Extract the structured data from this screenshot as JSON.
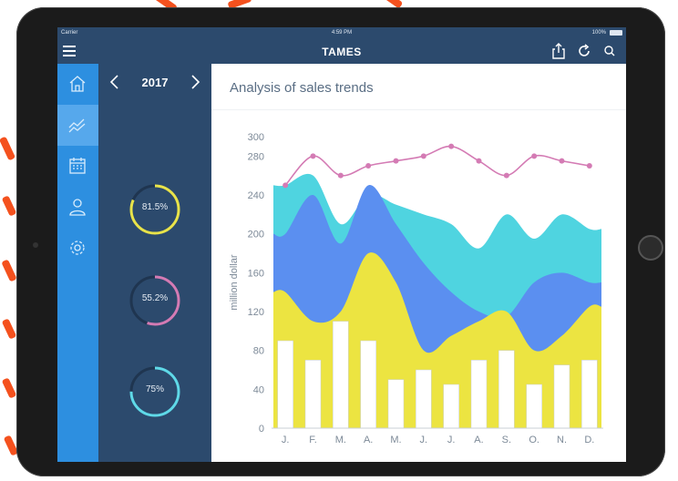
{
  "status_bar": {
    "carrier": "Carrier",
    "time": "4:59 PM",
    "battery": "100%"
  },
  "app": {
    "title": "TAMES"
  },
  "sidebar": {
    "items": [
      {
        "icon": "home-icon",
        "active": false
      },
      {
        "icon": "trend-icon",
        "active": true
      },
      {
        "icon": "calendar-icon",
        "active": false
      },
      {
        "icon": "user-icon",
        "active": false
      },
      {
        "icon": "settings-icon",
        "active": false
      }
    ]
  },
  "panel": {
    "year": "2017",
    "gauges": [
      {
        "label": "81.5%",
        "value": 0.815,
        "color": "#e8e34a"
      },
      {
        "label": "55.2%",
        "value": 0.552,
        "color": "#d47bb4"
      },
      {
        "label": "75%",
        "value": 0.75,
        "color": "#5fd9e8"
      }
    ],
    "gauge_track_color": "#1f3550"
  },
  "main": {
    "title": "Analysis of sales trends"
  },
  "chart_data": {
    "type": "area",
    "categories": [
      "J.",
      "F.",
      "M.",
      "A.",
      "M.",
      "J.",
      "J.",
      "A.",
      "S.",
      "O.",
      "N.",
      "D."
    ],
    "ylabel": "million dollar",
    "ylim": [
      0,
      300
    ],
    "yticks": [
      "0",
      "40",
      "80",
      "120",
      "160",
      "200",
      "240",
      "280",
      "300"
    ],
    "ytick_values": [
      0,
      40,
      80,
      120,
      160,
      200,
      240,
      280,
      300
    ],
    "grid": false,
    "series": [
      {
        "type": "line",
        "color": "#d47bb4",
        "values": [
          250,
          280,
          260,
          270,
          275,
          280,
          290,
          275,
          260,
          280,
          275,
          270
        ]
      },
      {
        "type": "area",
        "color": "#4fd4e0",
        "values": [
          250,
          260,
          210,
          240,
          230,
          220,
          210,
          185,
          220,
          195,
          220,
          205
        ]
      },
      {
        "type": "area",
        "color": "#5b8ff0",
        "values": [
          200,
          240,
          190,
          250,
          210,
          170,
          140,
          120,
          115,
          150,
          160,
          150
        ]
      },
      {
        "type": "area",
        "color": "#ece441",
        "values": [
          140,
          110,
          120,
          180,
          150,
          80,
          95,
          110,
          120,
          80,
          95,
          125
        ]
      },
      {
        "type": "bar",
        "color": "#ffffff",
        "values": [
          90,
          70,
          110,
          90,
          50,
          60,
          45,
          70,
          80,
          45,
          65,
          70
        ]
      }
    ]
  }
}
